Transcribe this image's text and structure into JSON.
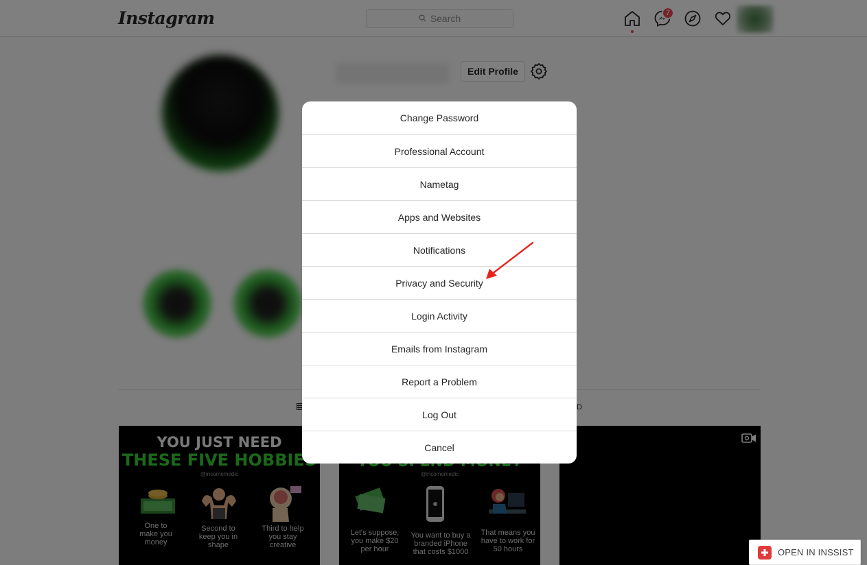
{
  "app": {
    "logo_text": "Instagram",
    "search_placeholder": "Search",
    "messenger_badge": "7"
  },
  "profile": {
    "edit_profile_label": "Edit Profile",
    "tab_fragment_right": "D"
  },
  "posts": [
    {
      "title_line1": "YOU JUST NEED",
      "title_line2": "THESE FIVE HOBBIES",
      "handle": "@incomemedic",
      "captions": [
        "One to make you money",
        "Second to keep you in shape",
        "Third to help you stay creative"
      ]
    },
    {
      "title_line1": "YOU SPEND MONEY",
      "handle": "@incomemedic",
      "captions": [
        "Let's suppose, you make $20 per hour",
        "You want to buy a branded iPhone that costs $1000",
        "That means you have to work for 50 hours"
      ]
    },
    {
      "type_icon": "video-icon"
    }
  ],
  "modal": {
    "items": [
      "Change Password",
      "Professional Account",
      "Nametag",
      "Apps and Websites",
      "Notifications",
      "Privacy and Security",
      "Login Activity",
      "Emails from Instagram",
      "Report a Problem",
      "Log Out",
      "Cancel"
    ]
  },
  "annotation": {
    "arrow_color": "#e8221b",
    "points_to": "Privacy and Security"
  },
  "extension": {
    "label": "OPEN IN INSSIST",
    "accent": "#e03b3b"
  },
  "colors": {
    "notification_red": "#ed4956",
    "border": "#dbdbdb",
    "brand_green": "#3fbf3f"
  }
}
